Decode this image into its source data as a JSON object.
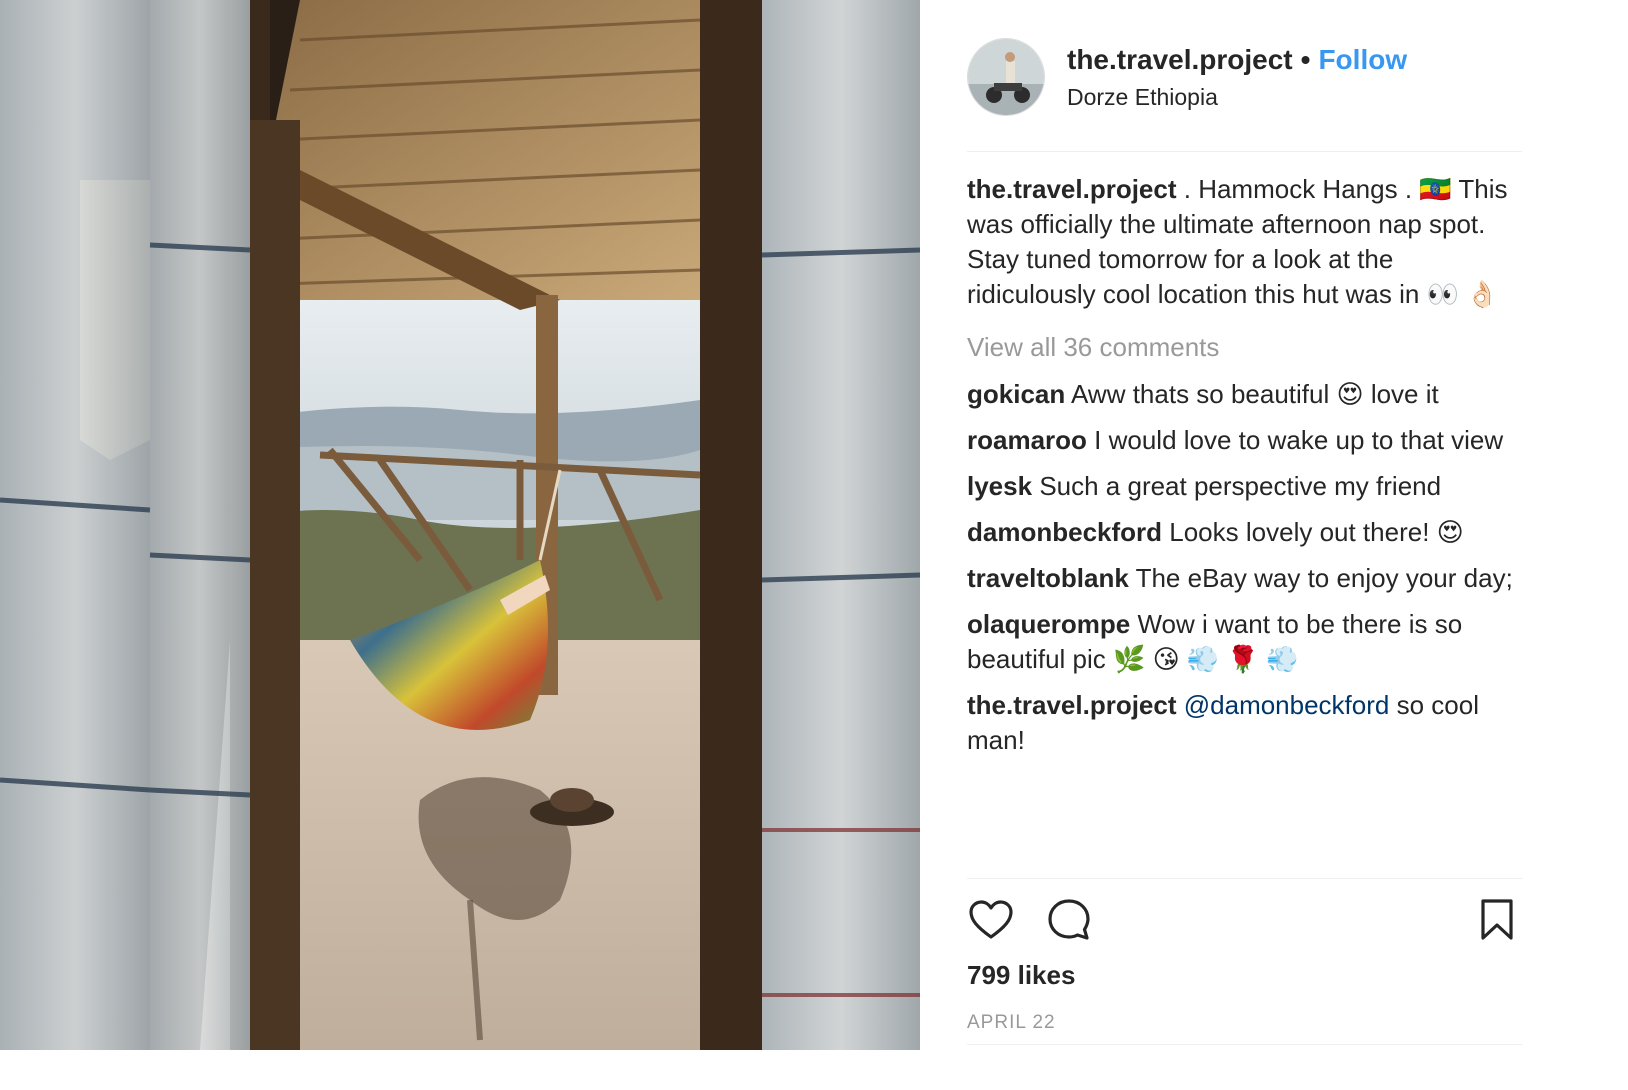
{
  "post": {
    "username": "the.travel.project",
    "separator": "•",
    "follow_label": "Follow",
    "location": "Dorze Ethiopia"
  },
  "caption": {
    "user": "the.travel.project",
    "text": ". Hammock Hangs . 🇪🇹 This was officially the ultimate afternoon nap spot. Stay tuned tomorrow for a look at the ridiculously cool location this hut was in 👀 👌🏻"
  },
  "view_all_comments": "View all 36 comments",
  "comments": [
    {
      "user": "gokican",
      "text": "Aww thats so beautiful 😍  love it"
    },
    {
      "user": "roamaroo",
      "text": "I would love to wake up to that view"
    },
    {
      "user": "lyesk",
      "text": "Such a great perspective my friend"
    },
    {
      "user": "damonbeckford",
      "text": "Looks lovely out there! 😍"
    },
    {
      "user": "traveltoblank",
      "text": "The eBay way to enjoy your day;"
    },
    {
      "user": "olaquerompe",
      "text": "Wow i want to be there is so beautiful pic 🌿 😘 💨 🌹 💨"
    }
  ],
  "reply": {
    "user": "the.travel.project",
    "mention": "@damonbeckford",
    "text": "so cool man!"
  },
  "icons": {
    "like": "heart-icon",
    "comment": "comment-bubble-icon",
    "save": "bookmark-icon"
  },
  "likes": "799 likes",
  "date": "APRIL 22",
  "colors": {
    "link_blue": "#3897f0",
    "mention_blue": "#003569",
    "muted": "#999999",
    "text": "#262626"
  }
}
